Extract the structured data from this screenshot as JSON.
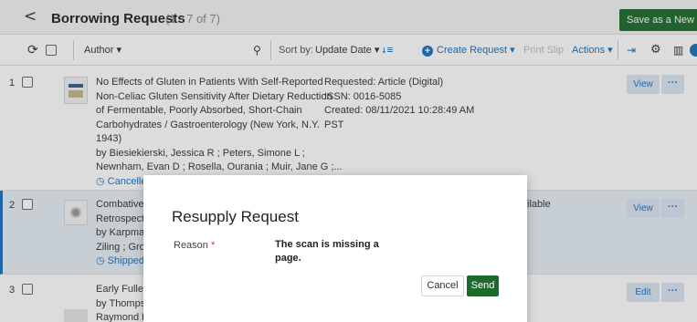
{
  "header": {
    "back_icon": "chevron-left-icon",
    "title": "Borrowing Requests",
    "count": "(1 - 7 of 7)",
    "save_button": "Save as a New Se"
  },
  "toolbar": {
    "refresh_icon": "refresh-icon",
    "filter_field": "Author",
    "sort_by_label": "Sort by:",
    "sort_field": "Update Date",
    "create_request": "Create Request",
    "print_slip": "Print Slip",
    "actions": "Actions"
  },
  "rows": [
    {
      "num": "1",
      "lines": [
        "No Effects of Gluten in Patients With Self-Reported",
        "Non-Celiac Gluten Sensitivity After Dietary Reduction",
        "of Fermentable, Poorly Absorbed, Short-Chain",
        "Carbohydrates / Gastroenterology (New York, N.Y.",
        "1943)",
        "by Biesiekierski, Jessica R ; Peters, Simone L ;",
        "Newnham, Evan D ; Rosella, Ourania ; Muir, Jane G ;..."
      ],
      "status": "Cancelled by staff",
      "details": [
        "Requested: Article (Digital)",
        "ISSN: 0016-5085",
        "Created: 08/11/2021 10:28:49 AM",
        "PST"
      ],
      "action": "View"
    },
    {
      "num": "2",
      "lines": [
        "Combative S",
        "Retrospectiv",
        "by Karpman",
        "Ziling ; Gros"
      ],
      "status": "Shipped",
      "details": [
        "ilable"
      ],
      "action": "View"
    },
    {
      "num": "3",
      "lines": [
        "Early Fullert",
        "by Thompso",
        "Raymond R."
      ],
      "action": "Edit"
    }
  ],
  "modal": {
    "title": "Resupply Request",
    "reason_label": "Reason",
    "required_mark": "*",
    "reason_value": "The scan is missing a page.",
    "cancel_label": "Cancel",
    "send_label": "Send"
  },
  "colors": {
    "primary_green": "#1c6b2c",
    "link_blue": "#1a6fbf",
    "selected_row": "#e6eff7"
  }
}
